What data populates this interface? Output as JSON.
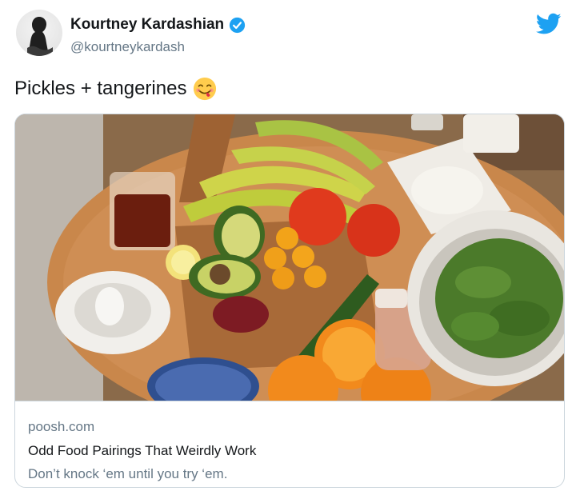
{
  "author": {
    "display_name": "Kourtney Kardashian",
    "handle": "@kourtneykardash",
    "verified": true,
    "avatar_icon": "person-silhouette-avatar"
  },
  "brand": {
    "icon": "twitter-bird-icon",
    "color": "#1da1f2"
  },
  "tweet": {
    "text": "Pickles + tangerines",
    "emoji": "face-savoring-food-emoji"
  },
  "card": {
    "image_icon": "food-table-photo",
    "domain": "poosh.com",
    "title": "Odd Food Pairings That Weirdly Work",
    "description": "Don’t knock ‘em until you try ‘em."
  },
  "colors": {
    "text_primary": "#14171a",
    "text_secondary": "#657786",
    "border": "#ccd6dd",
    "accent": "#1da1f2"
  }
}
